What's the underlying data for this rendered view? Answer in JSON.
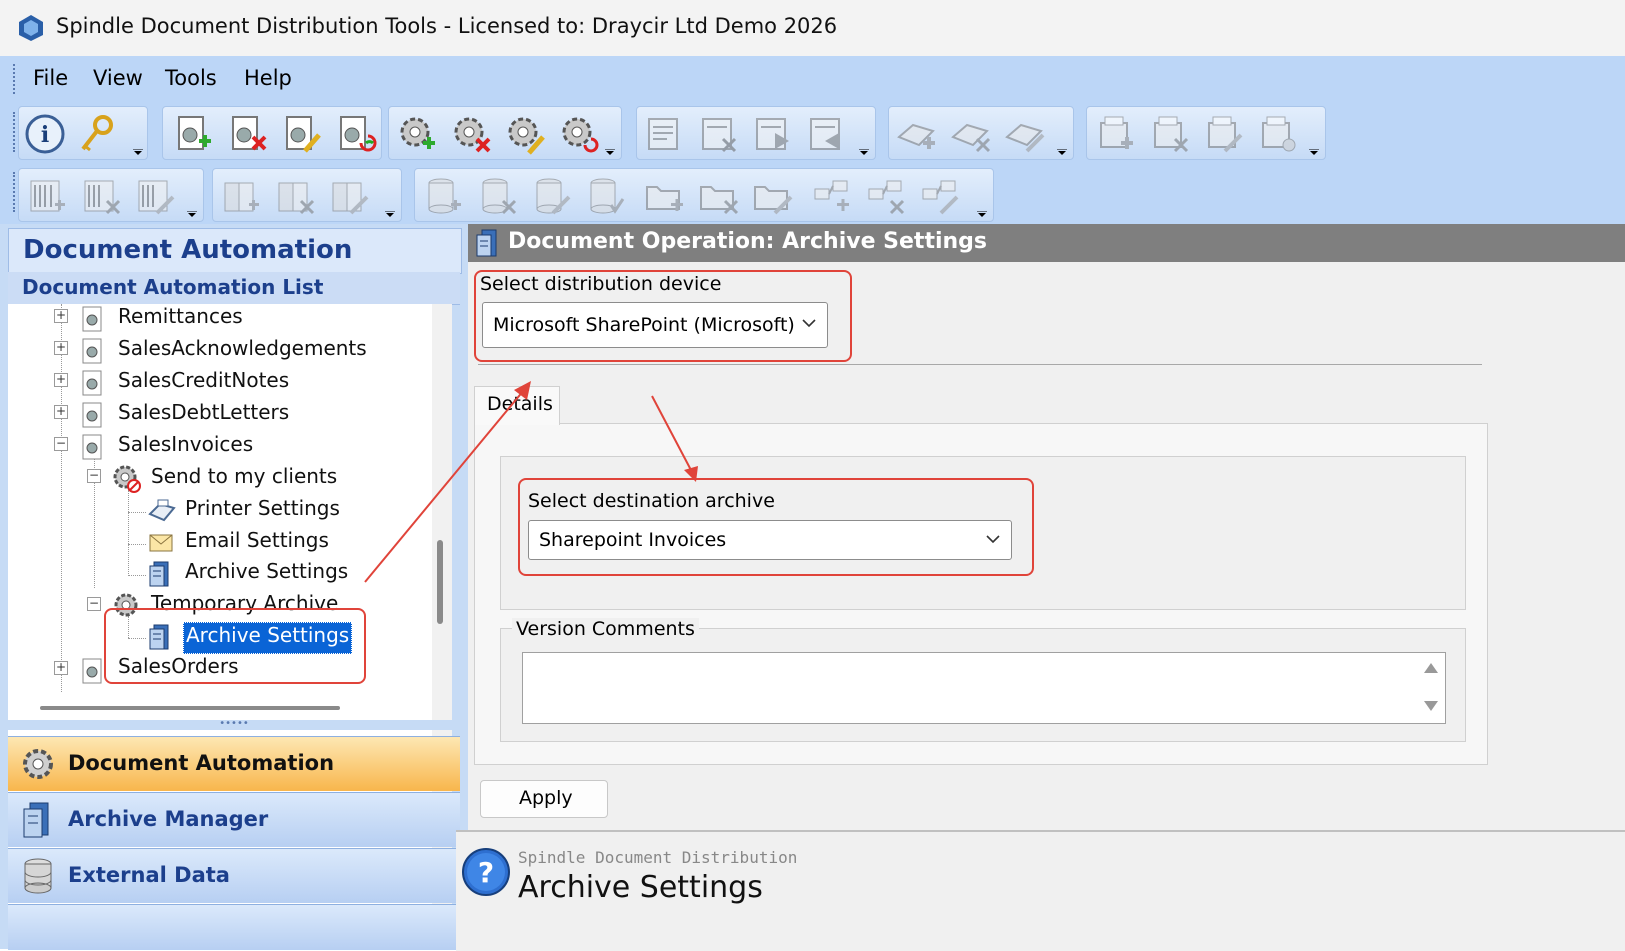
{
  "window": {
    "title": "Spindle Document Distribution Tools - Licensed to: Draycir Ltd Demo 2026"
  },
  "menu": {
    "items": [
      "File",
      "View",
      "Tools",
      "Help"
    ]
  },
  "left_panel": {
    "header": "Document Automation",
    "subheader": "Document Automation List",
    "tree": [
      {
        "label": "Remittances"
      },
      {
        "label": "SalesAcknowledgements"
      },
      {
        "label": "SalesCreditNotes"
      },
      {
        "label": "SalesDebtLetters"
      },
      {
        "label": "SalesInvoices"
      },
      {
        "label": "Send to my clients"
      },
      {
        "label": "Printer Settings"
      },
      {
        "label": "Email Settings"
      },
      {
        "label": "Archive Settings"
      },
      {
        "label": "Temporary Archive"
      },
      {
        "label": "Archive Settings"
      },
      {
        "label": "SalesOrders"
      }
    ],
    "nav_buttons": [
      "Document Automation",
      "Archive Manager",
      "External Data"
    ]
  },
  "right_panel": {
    "header": "Document Operation: Archive Settings",
    "distribution_device_label": "Select distribution device",
    "distribution_device_value": "Microsoft SharePoint (Microsoft)",
    "tab_label": "Details",
    "destination_archive_label": "Select destination archive",
    "destination_archive_value": "Sharepoint Invoices",
    "version_comments_label": "Version Comments",
    "version_comments_value": "",
    "apply_label": "Apply"
  },
  "help": {
    "product": "Spindle Document Distribution",
    "title": "Archive Settings"
  },
  "colors": {
    "accent_red": "#e0443a",
    "selection_blue": "#0a64d6",
    "toolbar_blue": "#bcd6f7",
    "active_nav_orange": "#f8b64c"
  }
}
